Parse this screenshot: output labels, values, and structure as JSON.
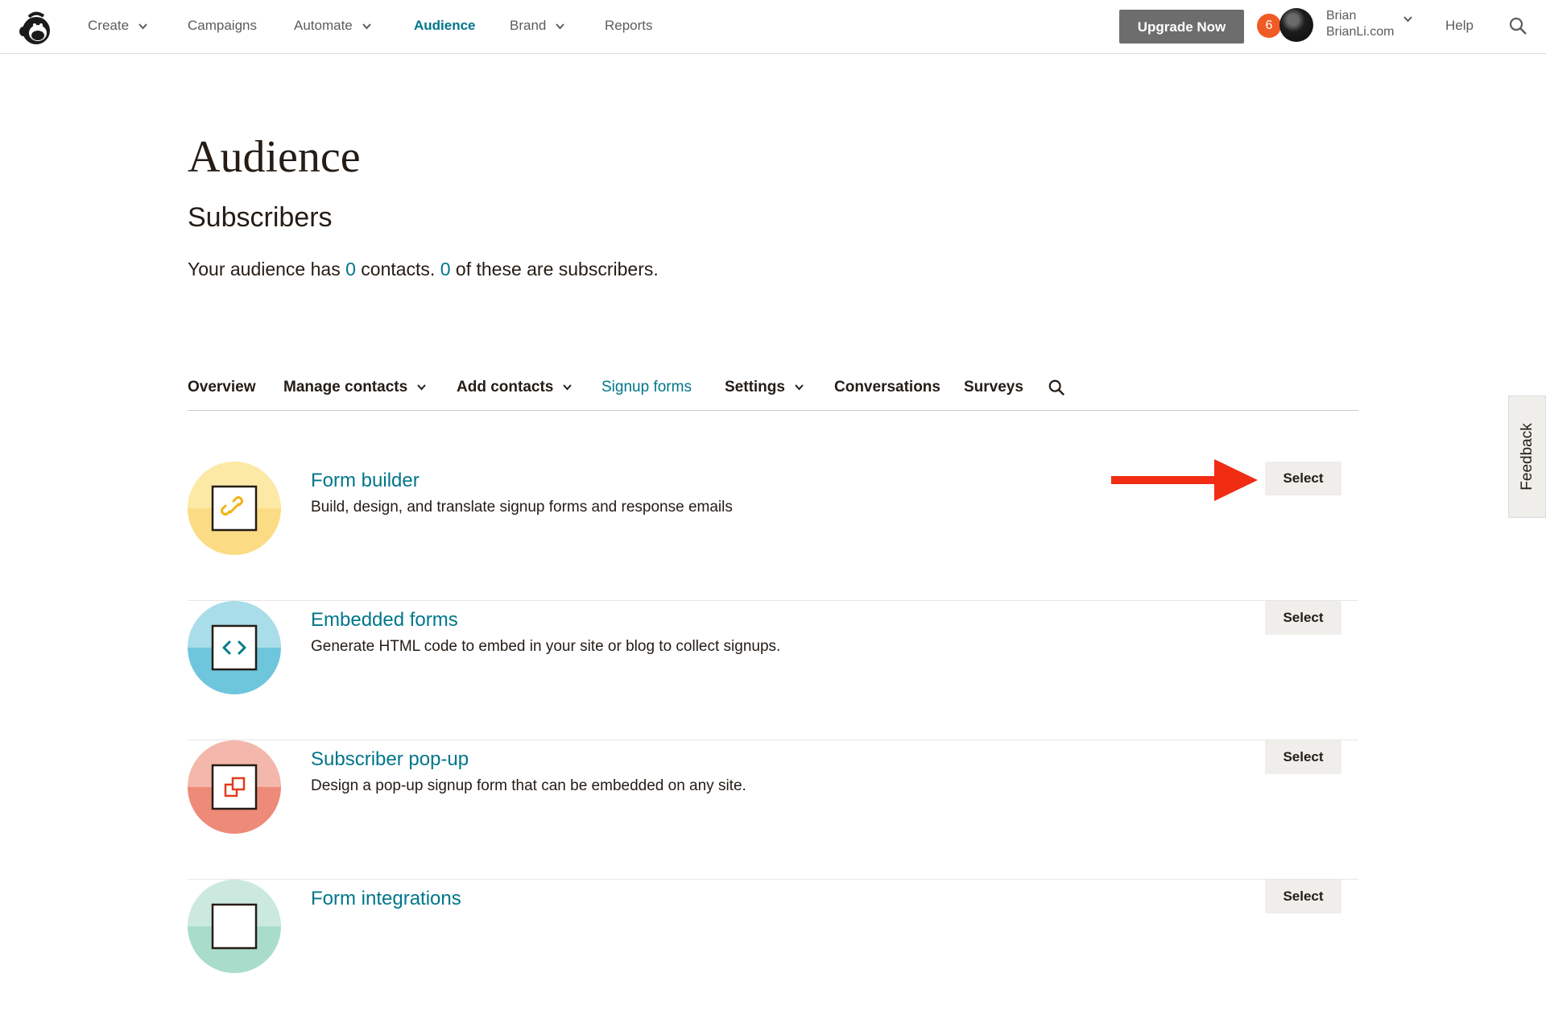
{
  "nav": {
    "items": [
      {
        "label": "Create",
        "has_caret": true
      },
      {
        "label": "Campaigns",
        "has_caret": false
      },
      {
        "label": "Automate",
        "has_caret": true
      },
      {
        "label": "Audience",
        "has_caret": false,
        "active": true
      },
      {
        "label": "Brand",
        "has_caret": true
      },
      {
        "label": "Reports",
        "has_caret": false
      }
    ],
    "upgrade_label": "Upgrade Now",
    "notification_count": "6",
    "user_first_name": "Brian",
    "user_site": "BrianLi.com",
    "help_label": "Help"
  },
  "page": {
    "title": "Audience",
    "section_title": "Subscribers",
    "summary": {
      "prefix": "Your audience has ",
      "contacts_count": "0",
      "middle": " contacts. ",
      "subscribers_count": "0",
      "suffix": " of these are subscribers."
    }
  },
  "subtabs": [
    {
      "label": "Overview",
      "has_caret": false
    },
    {
      "label": "Manage contacts",
      "has_caret": true
    },
    {
      "label": "Add contacts",
      "has_caret": true
    },
    {
      "label": "Signup forms",
      "has_caret": false,
      "active": true
    },
    {
      "label": "Settings",
      "has_caret": true
    },
    {
      "label": "Conversations",
      "has_caret": false
    },
    {
      "label": "Surveys",
      "has_caret": false
    }
  ],
  "forms": [
    {
      "title": "Form builder",
      "description": "Build, design, and translate signup forms and response emails",
      "button": "Select",
      "icon": "link-icon",
      "color_light": "#fde9a6",
      "color_dark": "#fbdc84",
      "glyph_color": "#f2b413"
    },
    {
      "title": "Embedded forms",
      "description": "Generate HTML code to embed in your site or blog to collect signups.",
      "button": "Select",
      "icon": "code-icon",
      "color_light": "#a9dde9",
      "color_dark": "#6ec6dd",
      "glyph_color": "#007c89"
    },
    {
      "title": "Subscriber pop-up",
      "description": "Design a pop-up signup form that can be embedded on any site.",
      "button": "Select",
      "icon": "popup-icon",
      "color_light": "#f3b7ab",
      "color_dark": "#ee8a78",
      "glyph_color": "#e13c1d"
    },
    {
      "title": "Form integrations",
      "description": "",
      "button": "Select",
      "icon": "integration-icon",
      "color_light": "#cbe9df",
      "color_dark": "#a9dccb",
      "glyph_color": "#2a8a6a"
    }
  ],
  "feedback_label": "Feedback",
  "colors": {
    "accent": "#00768a",
    "arrow": "#f02c12",
    "upgrade_bg": "#6d6d6d",
    "badge": "#ef5b25"
  }
}
